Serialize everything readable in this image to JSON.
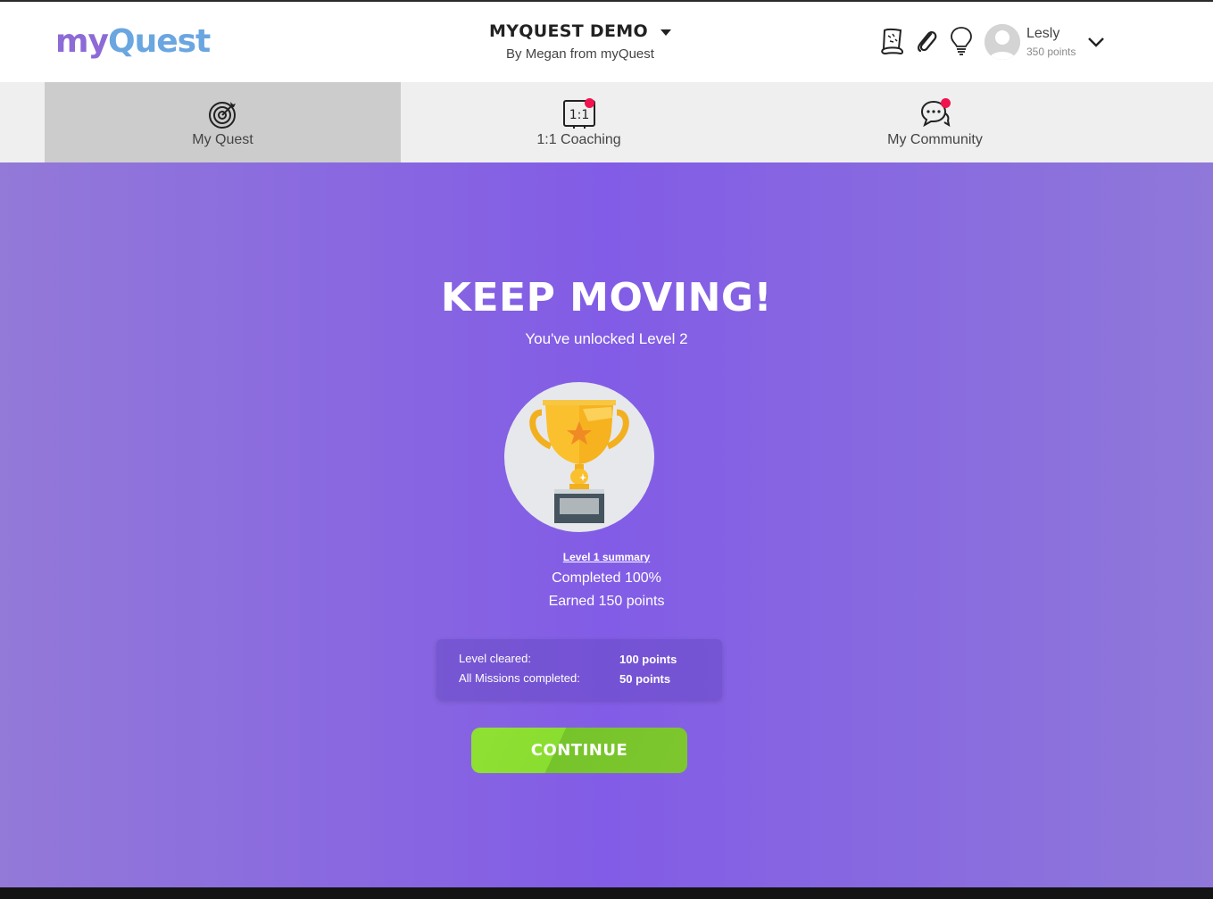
{
  "header": {
    "logo": {
      "part1": "my",
      "part2": "Quest"
    },
    "program_title": "MYQUEST DEMO",
    "program_subtitle": "By Megan from myQuest",
    "icons": [
      "map-scroll-icon",
      "paperclip-icon",
      "lightbulb-icon"
    ],
    "user": {
      "name": "Lesly",
      "points": "350 points"
    }
  },
  "tabs": [
    {
      "label": "My Quest",
      "icon": "target-icon",
      "active": true
    },
    {
      "label": "1:1 Coaching",
      "icon": "coaching-icon",
      "badge": true
    },
    {
      "label": "My Community",
      "icon": "chat-bubbles-icon",
      "badge": true
    }
  ],
  "main": {
    "headline": "KEEP MOVING!",
    "subline": "You've unlocked Level 2",
    "summary_link": "Level 1 summary",
    "completed": "Completed 100%",
    "earned": "Earned 150 points",
    "breakdown": [
      {
        "label": "Level cleared:",
        "value": "100 points"
      },
      {
        "label": "All Missions completed:",
        "value": "50 points"
      }
    ],
    "continue_label": "CONTINUE"
  },
  "colors": {
    "accent_purple": "#825ce6",
    "continue_green": "#8ade30",
    "badge_red": "#f0134d",
    "tab_active": "#cccccc",
    "tab_bar": "#efefef"
  }
}
